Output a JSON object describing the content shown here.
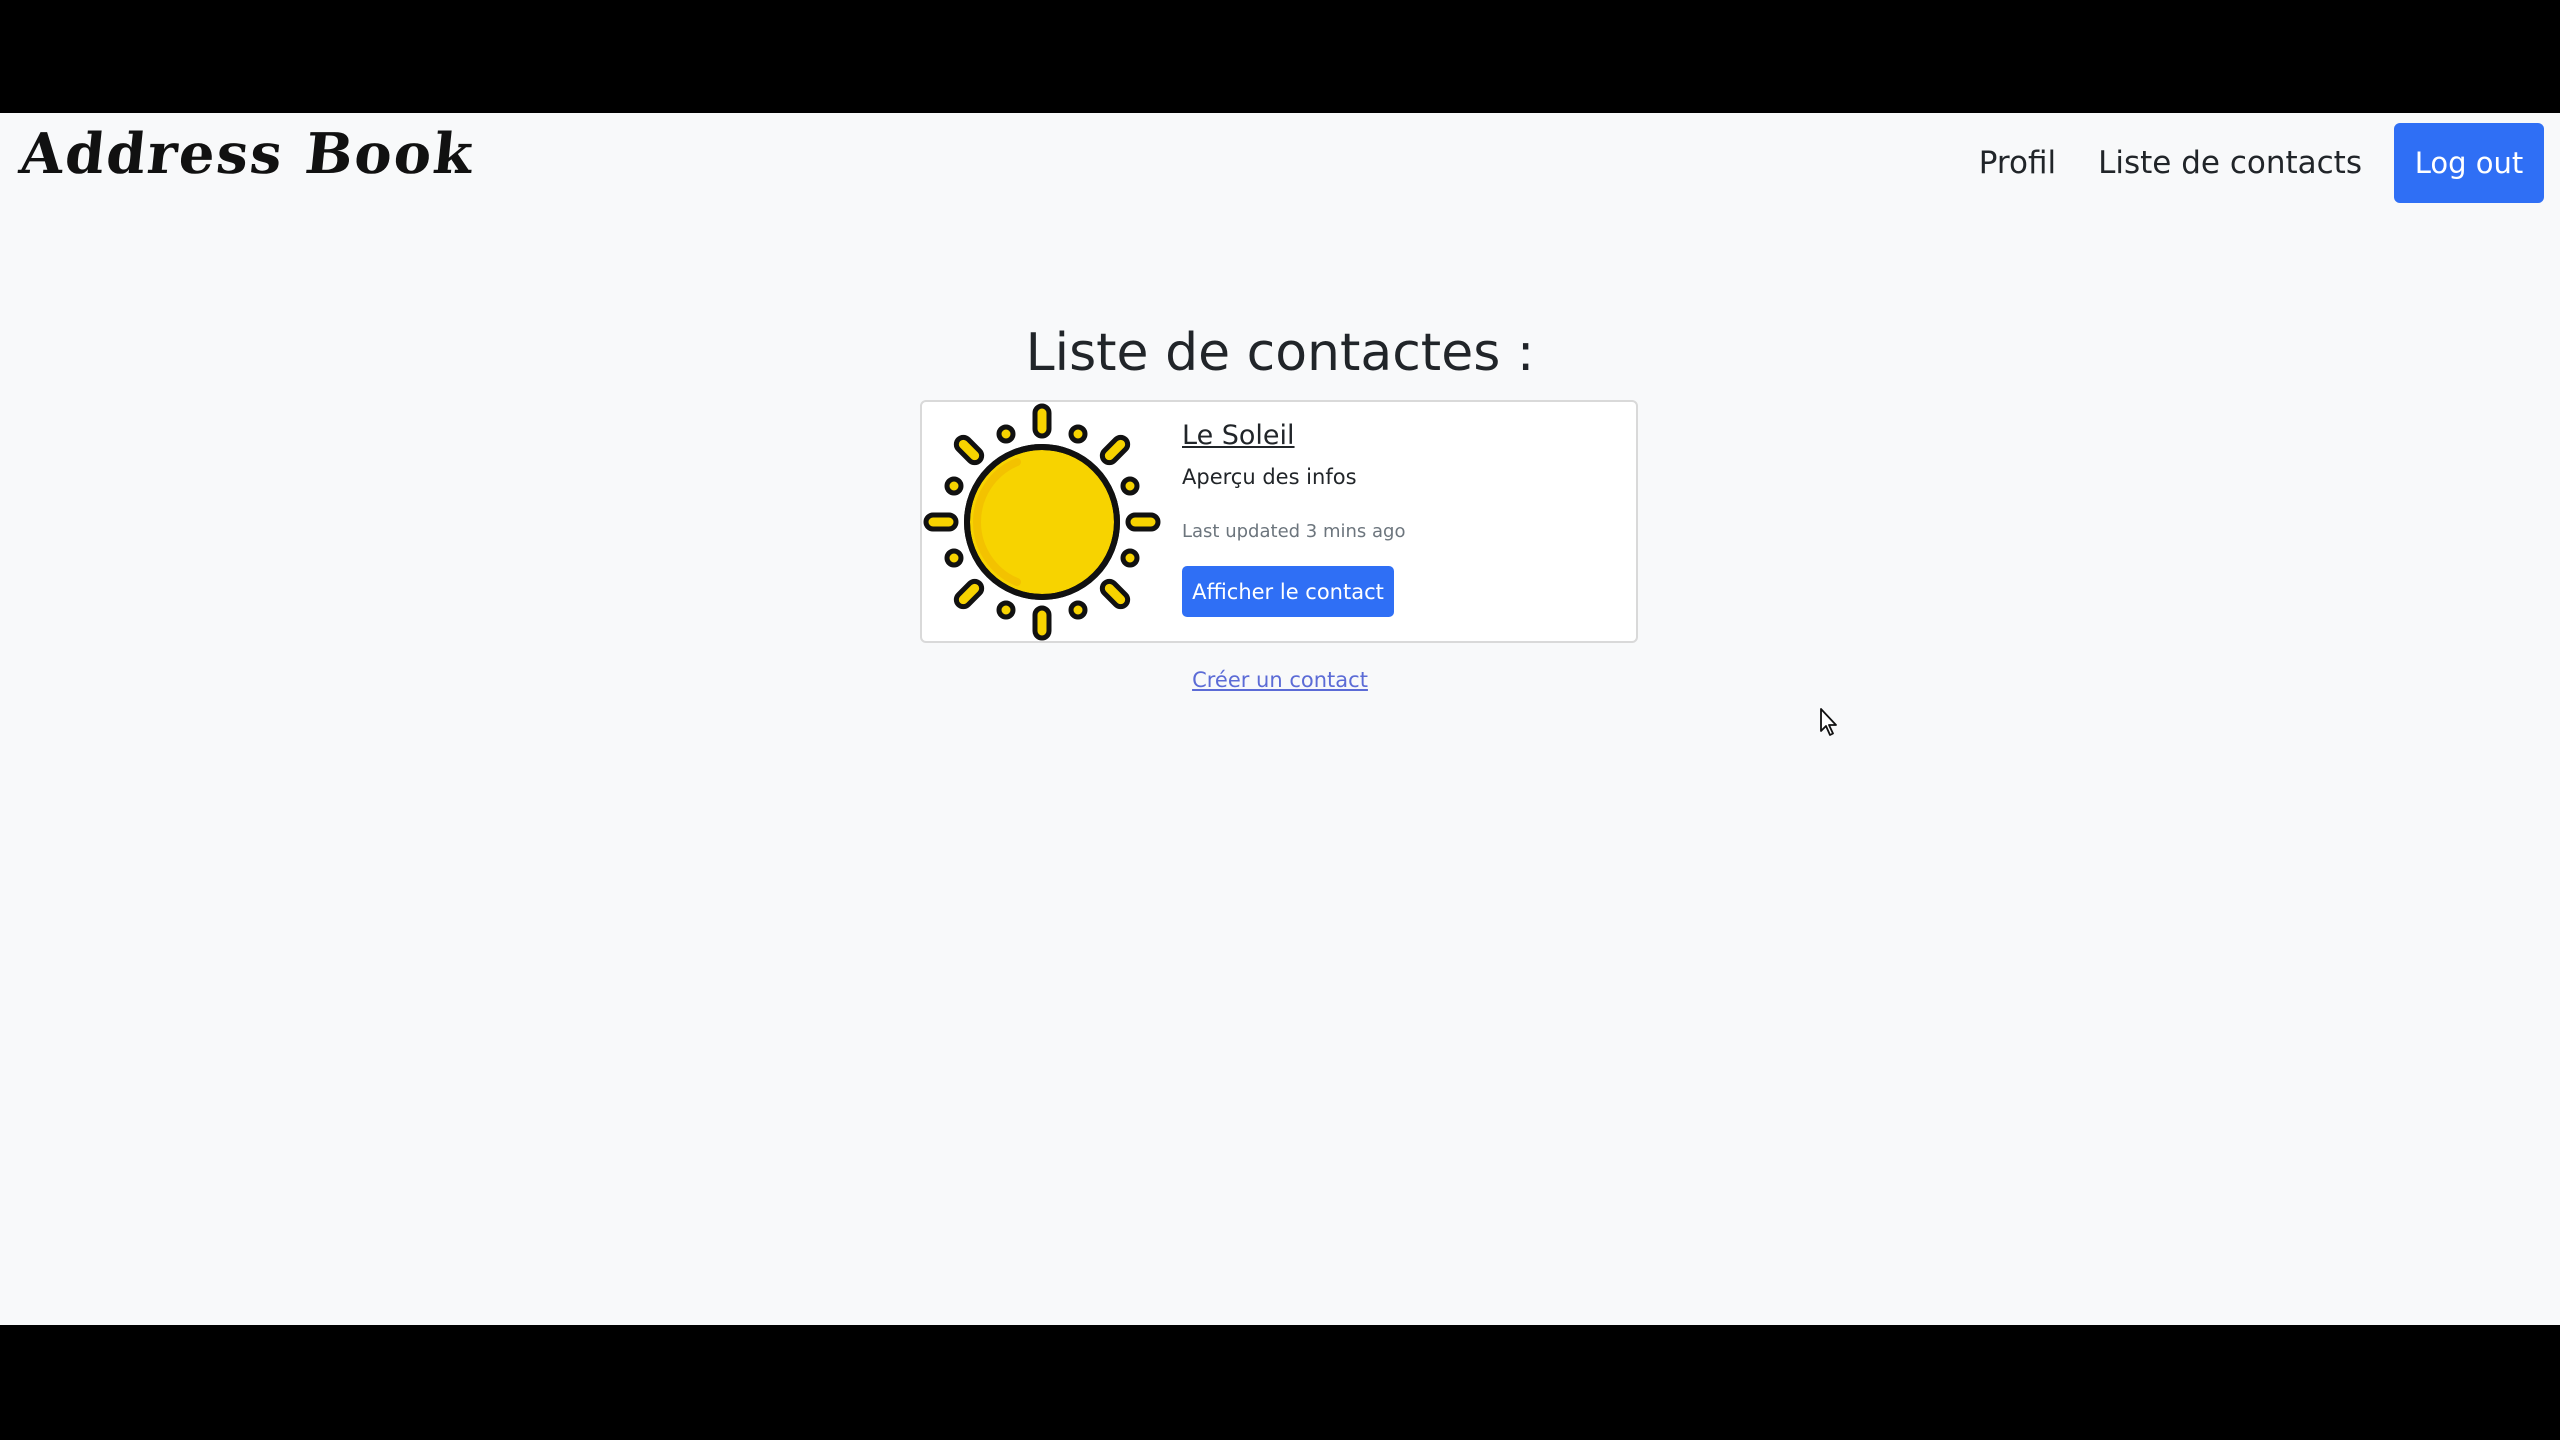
{
  "navbar": {
    "brand": "Address Book",
    "links": [
      "Profil",
      "Liste de contacts"
    ],
    "logout_label": "Log out"
  },
  "main": {
    "title": "Liste de contactes :",
    "contacts": [
      {
        "name": "Le Soleil",
        "preview": "Aperçu des infos",
        "updated": "Last updated 3 mins ago",
        "button_label": "Afficher le contact",
        "icon": "sun-icon"
      }
    ],
    "create_link": "Créer un contact"
  },
  "colors": {
    "primary": "#2f6ff5",
    "background": "#f8f9fa",
    "sun_fill": "#f7d300",
    "sun_outline": "#111111"
  }
}
